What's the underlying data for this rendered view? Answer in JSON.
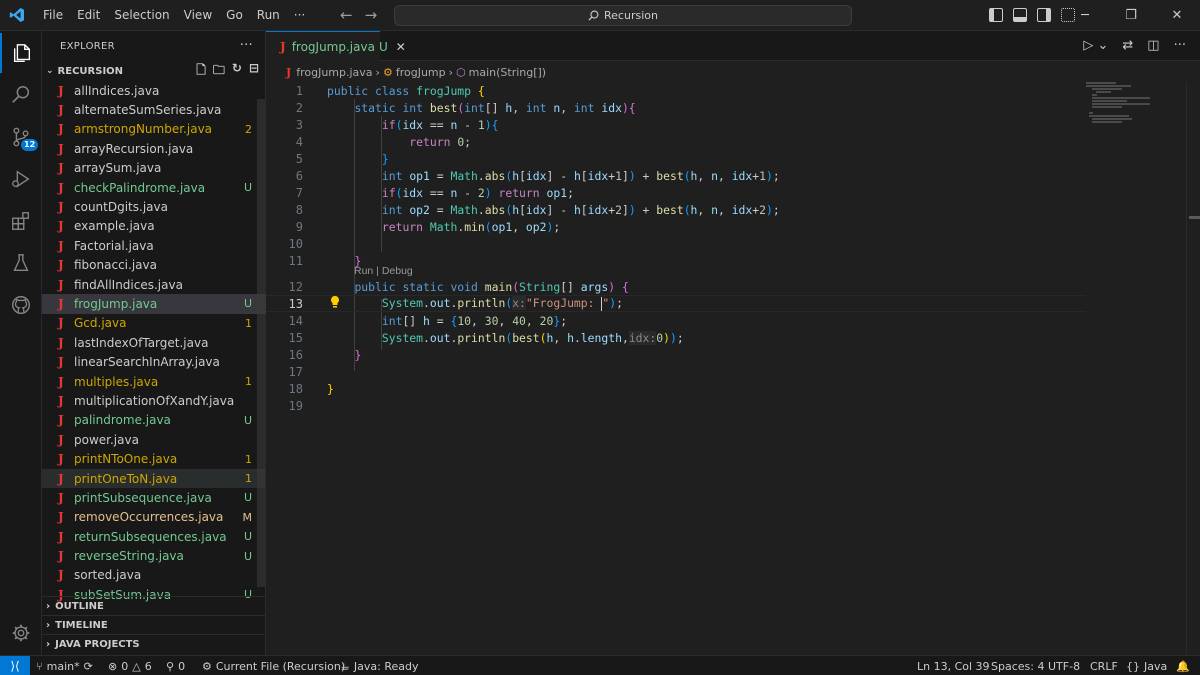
{
  "menu": [
    "File",
    "Edit",
    "Selection",
    "View",
    "Go",
    "Run",
    "···"
  ],
  "search": {
    "label": "Recursion"
  },
  "explorer": {
    "title": "EXPLORER",
    "project": "RECURSION",
    "files": [
      {
        "name": "allIndices.java",
        "status": "",
        "color": "default"
      },
      {
        "name": "alternateSumSeries.java",
        "status": "",
        "color": "default"
      },
      {
        "name": "armstrongNumber.java",
        "status": "2",
        "color": "err"
      },
      {
        "name": "arrayRecursion.java",
        "status": "",
        "color": "default"
      },
      {
        "name": "arraySum.java",
        "status": "",
        "color": "default"
      },
      {
        "name": "checkPalindrome.java",
        "status": "U",
        "color": "u"
      },
      {
        "name": "countDgits.java",
        "status": "",
        "color": "default"
      },
      {
        "name": "example.java",
        "status": "",
        "color": "default"
      },
      {
        "name": "Factorial.java",
        "status": "",
        "color": "default"
      },
      {
        "name": "fibonacci.java",
        "status": "",
        "color": "default"
      },
      {
        "name": "findAllIndices.java",
        "status": "",
        "color": "default"
      },
      {
        "name": "frogJump.java",
        "status": "U",
        "color": "u",
        "selected": true
      },
      {
        "name": "Gcd.java",
        "status": "1",
        "color": "err"
      },
      {
        "name": "lastIndexOfTarget.java",
        "status": "",
        "color": "default"
      },
      {
        "name": "linearSearchInArray.java",
        "status": "",
        "color": "default"
      },
      {
        "name": "multiples.java",
        "status": "1",
        "color": "err"
      },
      {
        "name": "multiplicationOfXandY.java",
        "status": "",
        "color": "default"
      },
      {
        "name": "palindrome.java",
        "status": "U",
        "color": "u"
      },
      {
        "name": "power.java",
        "status": "",
        "color": "default"
      },
      {
        "name": "printNToOne.java",
        "status": "1",
        "color": "err"
      },
      {
        "name": "printOneToN.java",
        "status": "1",
        "color": "err",
        "hover": true
      },
      {
        "name": "printSubsequence.java",
        "status": "U",
        "color": "u"
      },
      {
        "name": "removeOccurrences.java",
        "status": "M",
        "color": "m"
      },
      {
        "name": "returnSubsequences.java",
        "status": "U",
        "color": "u"
      },
      {
        "name": "reverseString.java",
        "status": "U",
        "color": "u"
      },
      {
        "name": "sorted.java",
        "status": "",
        "color": "default"
      },
      {
        "name": "subSetSum.java",
        "status": "U",
        "color": "u"
      }
    ],
    "sections": [
      "OUTLINE",
      "TIMELINE",
      "JAVA PROJECTS"
    ]
  },
  "activity": {
    "badge": "12"
  },
  "tab": {
    "name": "frogJump.java",
    "status": "U"
  },
  "breadcrumb": {
    "file": "frogJump.java",
    "cls": "frogJump",
    "method": "main(String[])"
  },
  "codelens": "Run | Debug",
  "lines": [
    "1",
    "2",
    "3",
    "4",
    "5",
    "6",
    "7",
    "8",
    "9",
    "10",
    "11",
    "12",
    "13",
    "14",
    "15",
    "16",
    "17",
    "18",
    "19"
  ],
  "status": {
    "branch": "main*",
    "problems": "0",
    "warnings": "6",
    "ports": "0",
    "current_file": "Current File (Recursion)",
    "java": "Java: Ready",
    "position": "Ln 13, Col 39",
    "spaces": "Spaces: 4",
    "encoding": "UTF-8",
    "eol": "CRLF",
    "language": "Java"
  }
}
